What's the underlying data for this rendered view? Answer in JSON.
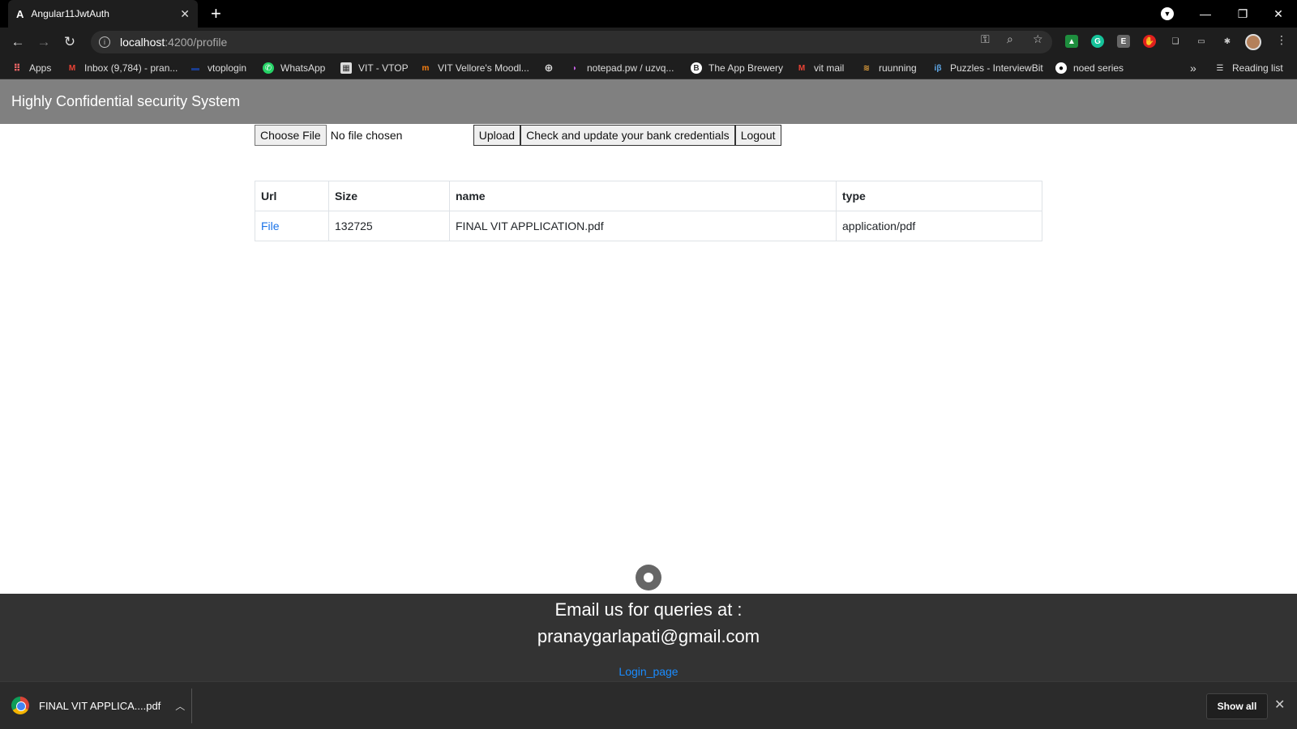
{
  "browser": {
    "tab_title": "Angular11JwtAuth",
    "url_host": "localhost",
    "url_path": ":4200/profile",
    "bookmarks": [
      {
        "label": "Apps",
        "icon": "apps-grid-icon"
      },
      {
        "label": "Inbox (9,784) - pran...",
        "icon": "gmail-icon"
      },
      {
        "label": "vtoplogin",
        "icon": "vtop-icon"
      },
      {
        "label": "WhatsApp",
        "icon": "whatsapp-icon"
      },
      {
        "label": "VIT - VTOP",
        "icon": "vit-icon"
      },
      {
        "label": "VIT Vellore's Moodl...",
        "icon": "moodle-icon"
      },
      {
        "label": "",
        "icon": "globe-icon"
      },
      {
        "label": "notepad.pw / uzvq...",
        "icon": "notepad-icon"
      },
      {
        "label": "The App Brewery",
        "icon": "appbrewery-icon"
      },
      {
        "label": "vit mail",
        "icon": "gmail-icon"
      },
      {
        "label": "ruunning",
        "icon": "running-icon"
      },
      {
        "label": "Puzzles - InterviewBit",
        "icon": "interviewbit-icon"
      },
      {
        "label": "noed series",
        "icon": "github-icon"
      }
    ],
    "reading_list": "Reading list",
    "more_bookmarks": "»"
  },
  "app": {
    "title": "Highly Confidential security System",
    "choose_file": "Choose File",
    "no_file": "No file chosen",
    "upload": "Upload",
    "bank": "Check and update your bank credentials",
    "logout": "Logout"
  },
  "table": {
    "headers": [
      "Url",
      "Size",
      "name",
      "type"
    ],
    "rows": [
      {
        "url": "File",
        "size": "132725",
        "name": "FINAL VIT APPLICATION.pdf",
        "type": "application/pdf"
      }
    ]
  },
  "footer": {
    "line1": "Email us for queries at :",
    "line2": "pranaygarlapati@gmail.com",
    "login": "Login_page"
  },
  "downloads": {
    "file": "FINAL VIT APPLICA....pdf",
    "show_all": "Show all"
  }
}
